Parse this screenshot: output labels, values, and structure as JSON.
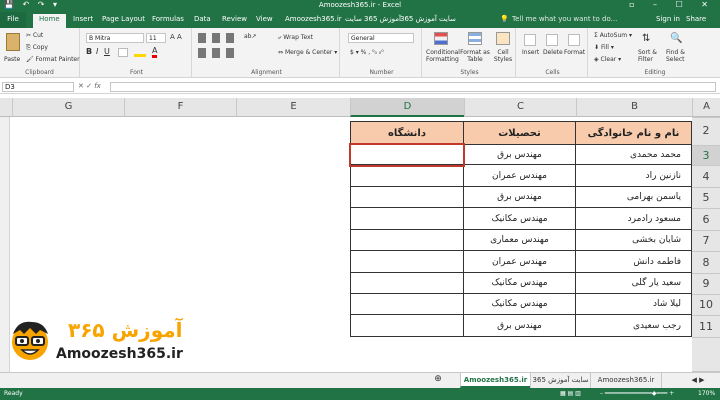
{
  "window": {
    "title": "Amoozesh365.ir - Excel",
    "signin": "Sign in",
    "share": "Share"
  },
  "tabs": [
    "File",
    "Home",
    "Insert",
    "Page Layout",
    "Formulas",
    "Data",
    "Review",
    "View",
    "Amoozesh365.ir",
    "آموزش 365 سایت",
    "سایت آموزش 365"
  ],
  "tell_me": "Tell me what you want to do...",
  "ribbon": {
    "clipboard": {
      "label": "Clipboard",
      "paste": "Paste",
      "cut": "Cut",
      "copy": "Copy",
      "format_painter": "Format Painter"
    },
    "font": {
      "label": "Font",
      "name": "B Mitra",
      "size": "11"
    },
    "alignment": {
      "label": "Alignment",
      "wrap": "Wrap Text",
      "merge": "Merge & Center"
    },
    "number": {
      "label": "Number",
      "format": "General"
    },
    "styles": {
      "label": "Styles",
      "conditional": "Conditional Formatting",
      "format_table": "Format as Table",
      "cell_styles": "Cell Styles"
    },
    "cells": {
      "label": "Cells",
      "insert": "Insert",
      "delete": "Delete",
      "format": "Format"
    },
    "editing": {
      "label": "Editing",
      "autosum": "AutoSum",
      "fill": "Fill",
      "clear": "Clear",
      "sort": "Sort & Filter",
      "find": "Find & Select"
    }
  },
  "namebox": "D3",
  "fx": "fx",
  "columns": [
    "A",
    "B",
    "C",
    "D",
    "E",
    "F",
    "G"
  ],
  "rows": [
    "2",
    "3",
    "4",
    "5",
    "6",
    "7",
    "8",
    "9",
    "10",
    "11"
  ],
  "table": {
    "headers": {
      "name": "نام و نام خانوادگی",
      "edu": "تحصیلات",
      "uni": "دانشگاه"
    },
    "rows": [
      {
        "name": "محمد محمدی",
        "edu": "مهندس برق",
        "uni": ""
      },
      {
        "name": "نازنین راد",
        "edu": "مهندس عمران",
        "uni": ""
      },
      {
        "name": "یاسمن بهرامی",
        "edu": "مهندس برق",
        "uni": ""
      },
      {
        "name": "مسعود رادمرد",
        "edu": "مهندس مکانیک",
        "uni": ""
      },
      {
        "name": "شایان بخشی",
        "edu": "مهندس معماری",
        "uni": ""
      },
      {
        "name": "فاطمه دانش",
        "edu": "مهندس عمران",
        "uni": ""
      },
      {
        "name": "سعید یار گلی",
        "edu": "مهندس مکانیک",
        "uni": ""
      },
      {
        "name": "لیلا شاد",
        "edu": "مهندس مکانیک",
        "uni": ""
      },
      {
        "name": "رجب سعیدی",
        "edu": "مهندس برق",
        "uni": ""
      }
    ]
  },
  "logo": {
    "brand": "آموزش ۳۶۵",
    "url": "Amoozesh365.ir"
  },
  "sheet_tabs": [
    "Amoozesh365.ir",
    "سایت آموزش 365",
    "Amoozesh365.ir"
  ],
  "status": {
    "ready": "Ready",
    "zoom": "170%"
  }
}
